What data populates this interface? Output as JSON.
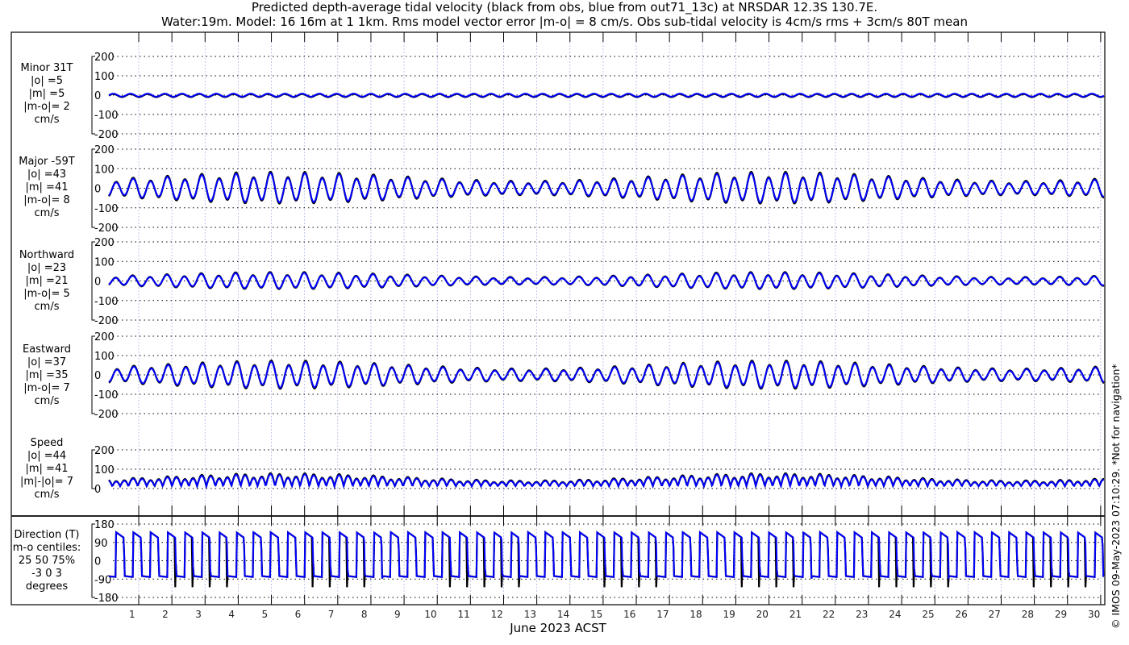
{
  "title_line1": "Predicted depth-average tidal velocity (black from obs, blue from out71_13c) at NRSDAR 12.3S 130.7E.",
  "title_line2": "Water:19m. Model: 16 16m at 1 1km. Rms model vector error |m-o| = 8 cm/s. Obs sub-tidal velocity is 4cm/s rms + 3cm/s 80T mean",
  "xlabel": "June 2023 ACST",
  "side_note": "© IMOS 09-May-2023 07:10:29. *Not for navigation*",
  "colors": {
    "obs": "#000000",
    "model": "#0000ff",
    "vgrid": "#b0b8e8"
  },
  "chart_data": {
    "type": "line",
    "title": "Predicted depth-average tidal velocity",
    "xlabel": "June 2023 ACST",
    "x_ticks": [
      "1",
      "2",
      "3",
      "4",
      "5",
      "6",
      "7",
      "8",
      "9",
      "10",
      "11",
      "12",
      "13",
      "14",
      "15",
      "16",
      "17",
      "18",
      "19",
      "20",
      "21",
      "22",
      "23",
      "24",
      "25",
      "26",
      "27",
      "28",
      "29",
      "30"
    ],
    "xlim_days": [
      0.3,
      30.3
    ],
    "legend": "black from obs, blue from model (in title)",
    "panels": [
      {
        "name": "minor",
        "labels": [
          "Minor 31T",
          "|o| =5",
          "|m| =5",
          "|m-o|= 2",
          "cm/s"
        ],
        "ylim": [
          -200,
          200
        ],
        "yticks": [
          "200",
          "100",
          "0",
          "-100",
          "-200"
        ],
        "amp_obs": 8,
        "amp_model": 8
      },
      {
        "name": "major",
        "labels": [
          "Major -59T",
          "|o| =43",
          "|m| =41",
          "|m-o|= 8",
          "cm/s"
        ],
        "ylim": [
          -200,
          200
        ],
        "yticks": [
          "200",
          "100",
          "0",
          "-100",
          "-200"
        ],
        "amp_obs": 65,
        "amp_model": 62
      },
      {
        "name": "northward",
        "labels": [
          "Northward",
          "|o| =23",
          "|m| =21",
          "|m-o|= 5",
          "cm/s"
        ],
        "ylim": [
          -200,
          200
        ],
        "yticks": [
          "200",
          "100",
          "0",
          "-100",
          "-200"
        ],
        "amp_obs": 35,
        "amp_model": 33
      },
      {
        "name": "eastward",
        "labels": [
          "Eastward",
          "|o| =37",
          "|m| =35",
          "|m-o|= 7",
          "cm/s"
        ],
        "ylim": [
          -200,
          200
        ],
        "yticks": [
          "200",
          "100",
          "0",
          "-100",
          "-200"
        ],
        "amp_obs": 58,
        "amp_model": 55
      },
      {
        "name": "speed",
        "labels": [
          "Speed",
          "|o| =44",
          "|m| =41",
          "|m|-|o|= 7",
          "cm/s"
        ],
        "ylim": [
          0,
          200
        ],
        "yticks": [
          "200",
          "100",
          "0"
        ],
        "amp_obs": 65,
        "amp_model": 62
      },
      {
        "name": "direction",
        "labels": [
          "Direction (T)",
          "m-o centiles:",
          "25  50  75%",
          "-3  0  3",
          "degrees"
        ],
        "ylim": [
          -180,
          180
        ],
        "yticks": [
          "180",
          "90",
          "0",
          "-90",
          "-180"
        ]
      }
    ]
  }
}
